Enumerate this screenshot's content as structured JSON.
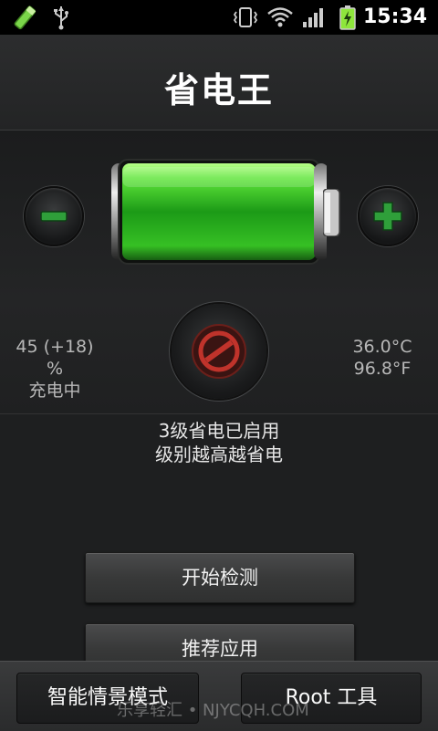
{
  "status_bar": {
    "time": "15:34",
    "icons": [
      "pen-icon",
      "usb-icon",
      "vibrate-icon",
      "wifi-icon",
      "signal-icon",
      "battery-charging-icon"
    ]
  },
  "header": {
    "title": "省电王"
  },
  "battery": {
    "level_fraction": 0.45,
    "percent_text": "45 (+18) %",
    "state_text": "充电中",
    "temp_c": "36.0°C",
    "temp_f": "96.8°F",
    "accent_color": "#3fcf2a"
  },
  "status": {
    "line1": "3级省电已启用",
    "line2": "级别越高越省电"
  },
  "actions": {
    "start_check": "开始检测",
    "recommend_apps": "推荐应用"
  },
  "bottom_bar": {
    "smart_mode": "智能情景模式",
    "root_tools": "Root 工具"
  },
  "watermark": "乐享轻汇 • NJYCQH.COM",
  "colors": {
    "power_off_red": "#c0332b",
    "plus_minus_green": "#2f9f3a"
  }
}
